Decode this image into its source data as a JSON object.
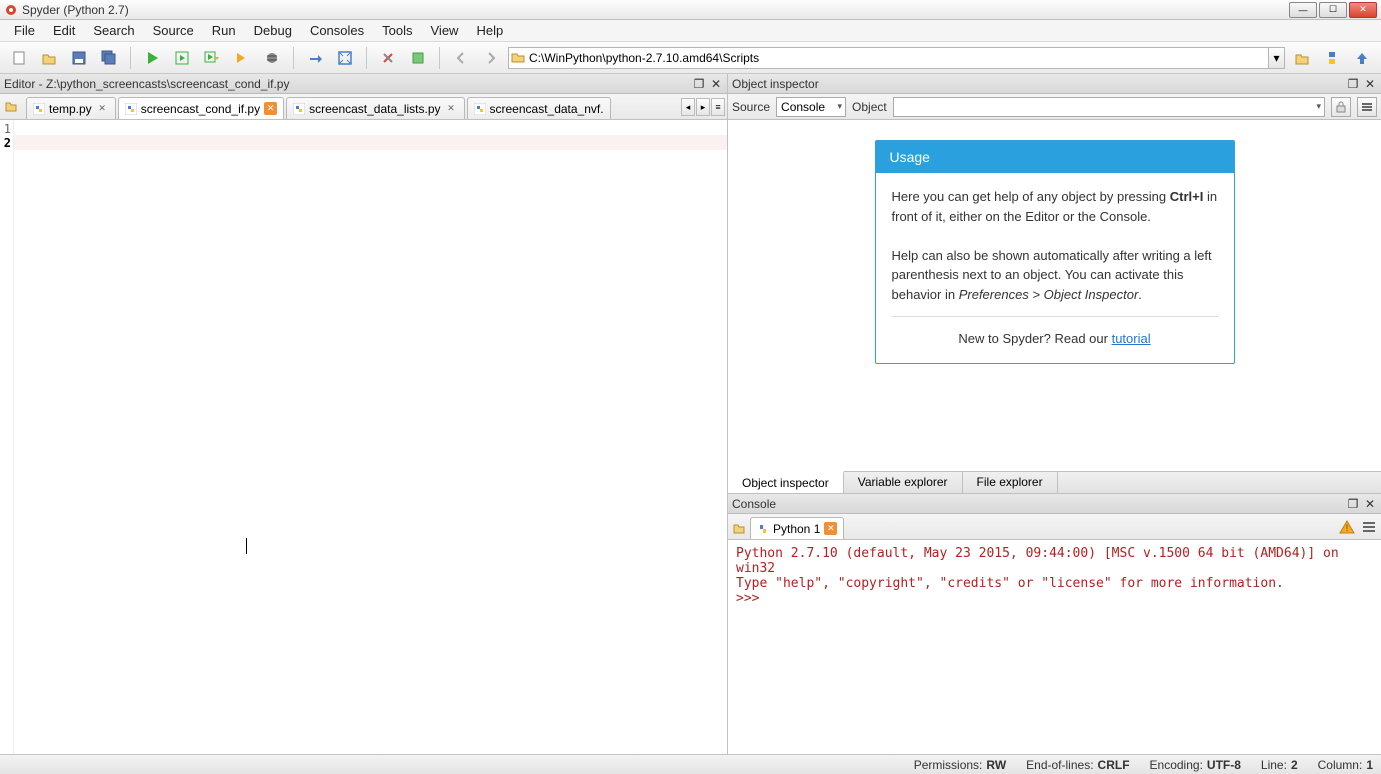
{
  "window": {
    "title": "Spyder (Python 2.7)"
  },
  "menubar": [
    "File",
    "Edit",
    "Search",
    "Source",
    "Run",
    "Debug",
    "Consoles",
    "Tools",
    "View",
    "Help"
  ],
  "toolbar": {
    "path": "C:\\WinPython\\python-2.7.10.amd64\\Scripts"
  },
  "editor": {
    "pane_title": "Editor - Z:\\python_screencasts\\screencast_cond_if.py",
    "tabs": [
      {
        "label": "temp.py",
        "active": false,
        "dirty": false
      },
      {
        "label": "screencast_cond_if.py",
        "active": true,
        "dirty": true
      },
      {
        "label": "screencast_data_lists.py",
        "active": false,
        "dirty": false
      },
      {
        "label": "screencast_data_nvf.",
        "active": false,
        "dirty": false
      }
    ],
    "line_numbers": [
      "1",
      "2"
    ]
  },
  "inspector": {
    "pane_title": "Object inspector",
    "source_label": "Source",
    "source_value": "Console",
    "object_label": "Object",
    "usage_header": "Usage",
    "usage_p1a": "Here you can get help of any object by pressing ",
    "usage_p1b": "Ctrl+I",
    "usage_p1c": " in front of it, either on the Editor or the Console.",
    "usage_p2a": "Help can also be shown automatically after writing a left parenthesis next to an object. You can activate this behavior in ",
    "usage_p2b": "Preferences > Object Inspector",
    "usage_p2c": ".",
    "usage_p3a": "New to Spyder? Read our ",
    "usage_p3b": "tutorial",
    "bottom_tabs": [
      "Object inspector",
      "Variable explorer",
      "File explorer"
    ]
  },
  "console": {
    "pane_title": "Console",
    "tab_label": "Python 1",
    "output": "Python 2.7.10 (default, May 23 2015, 09:44:00) [MSC v.1500 64 bit (AMD64)] on win32\nType \"help\", \"copyright\", \"credits\" or \"license\" for more information.\n>>> "
  },
  "statusbar": {
    "perm_label": "Permissions:",
    "perm_val": "RW",
    "eol_label": "End-of-lines:",
    "eol_val": "CRLF",
    "enc_label": "Encoding:",
    "enc_val": "UTF-8",
    "line_label": "Line:",
    "line_val": "2",
    "col_label": "Column:",
    "col_val": "1"
  }
}
